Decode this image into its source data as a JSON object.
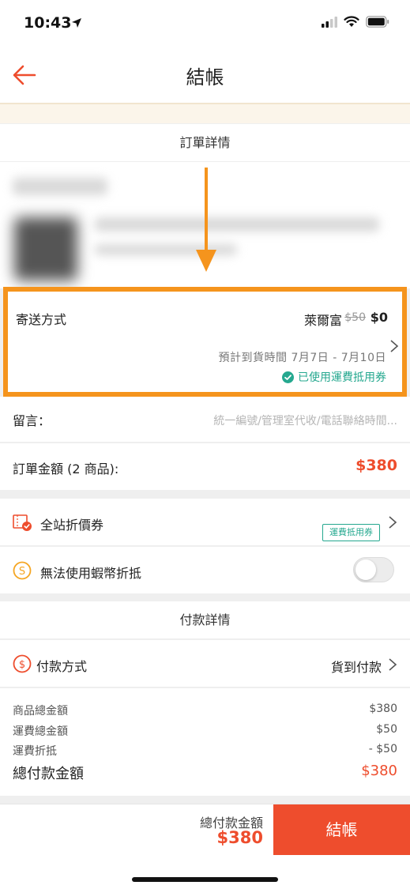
{
  "status_bar": {
    "time": "10:43"
  },
  "nav": {
    "title": "結帳"
  },
  "order_section": {
    "title": "訂單詳情"
  },
  "shipping": {
    "label": "寄送方式",
    "carrier": "萊爾富",
    "original_fee": "$50",
    "fee": "$0",
    "eta": "預計到貨時間 7月7日 - 7月10日",
    "voucher_note": "已使用運費抵用券"
  },
  "message": {
    "label": "留言：",
    "placeholder": "統一編號/管理室代收/電話聯絡時間..."
  },
  "order_total": {
    "label": "訂單金額 (2 商品):",
    "value": "$380"
  },
  "voucher_row": {
    "label": "全站折價券",
    "tag": "運費抵用券"
  },
  "coin_row": {
    "label": "無法使用蝦幣折抵",
    "enabled": false
  },
  "payment_section": {
    "title": "付款詳情"
  },
  "payment_method": {
    "label": "付款方式",
    "value": "貨到付款"
  },
  "summary": {
    "items": [
      {
        "label": "商品總金額",
        "value": "$380"
      },
      {
        "label": "運費總金額",
        "value": "$50"
      },
      {
        "label": "運費折抵",
        "value": "- $50"
      }
    ],
    "grand_label": "總付款金額",
    "grand_value": "$380"
  },
  "bottom_bar": {
    "label": "總付款金額",
    "amount": "$380",
    "checkout_label": "結帳"
  },
  "colors": {
    "accent": "#ee4d2d",
    "highlight": "#f5941d",
    "teal": "#25a88f"
  }
}
